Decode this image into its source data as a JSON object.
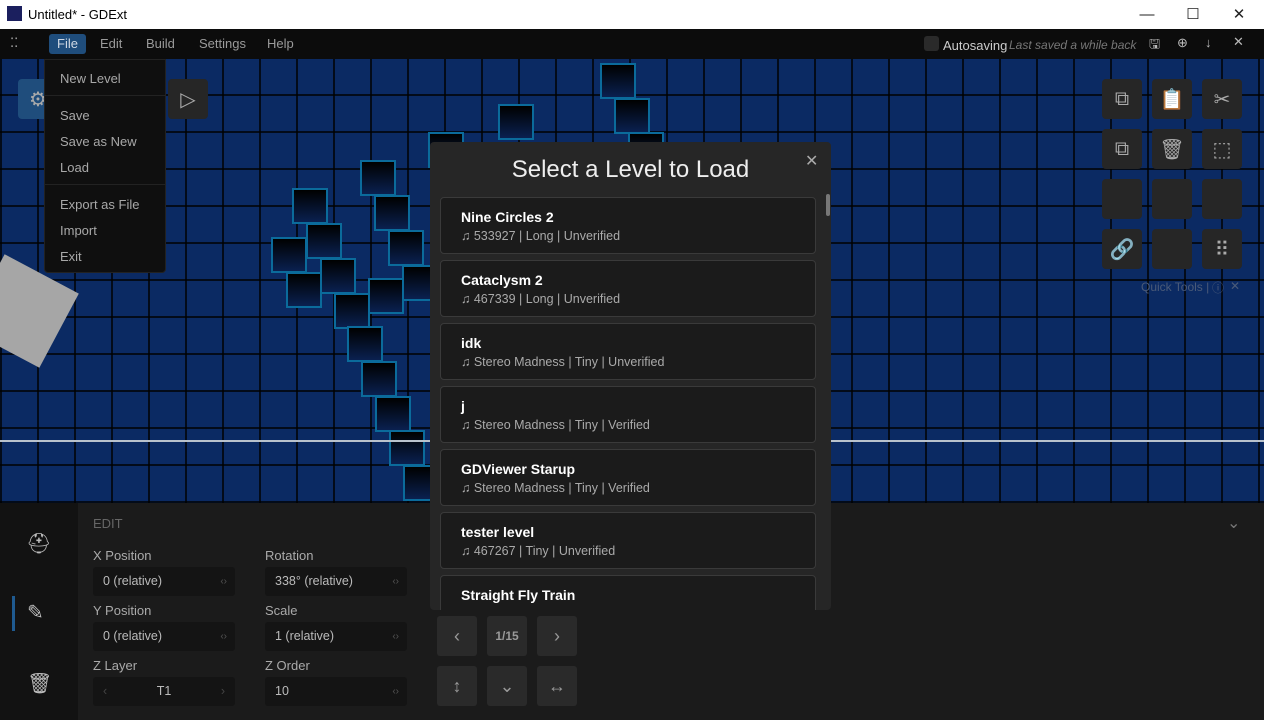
{
  "window": {
    "title": "Untitled* - GDExt",
    "minimize": "—",
    "maximize": "☐",
    "close": "✕"
  },
  "menubar": {
    "items": [
      "File",
      "Edit",
      "Build",
      "Settings",
      "Help"
    ],
    "autosave_label": "Autosaving",
    "last_saved": "Last saved a while back"
  },
  "file_menu": {
    "items": [
      "New Level",
      "Save",
      "Save as New",
      "Load",
      "Export as File",
      "Import",
      "Exit"
    ]
  },
  "quick_tools": {
    "label": "Quick Tools |"
  },
  "modal": {
    "title": "Select a Level to Load",
    "close": "✕",
    "levels": [
      {
        "name": "Nine Circles 2",
        "meta": "♫ 533927 | Long | Unverified"
      },
      {
        "name": "Cataclysm 2",
        "meta": "♫ 467339 | Long | Unverified"
      },
      {
        "name": "idk",
        "meta": "♫ Stereo Madness | Tiny | Unverified"
      },
      {
        "name": "j",
        "meta": "♫ Stereo Madness | Tiny | Verified"
      },
      {
        "name": "GDViewer Starup",
        "meta": "♫ Stereo Madness | Tiny | Verified"
      },
      {
        "name": "tester level",
        "meta": "♫ 467267 | Tiny | Unverified"
      },
      {
        "name": "Straight Fly Train",
        "meta": ""
      }
    ]
  },
  "edit": {
    "section": "EDIT",
    "x_label": "X Position",
    "x_value": "0 (relative)",
    "rot_label": "Rotation",
    "rot_value": "338° (relative)",
    "y_label": "Y Position",
    "y_value": "0 (relative)",
    "scale_label": "Scale",
    "scale_value": "1 (relative)",
    "zl_label": "Z Layer",
    "zl_value": "T1",
    "zo_label": "Z Order",
    "zo_value": "10",
    "page": "1/15"
  },
  "colors": {
    "accent": "#1f4d7c",
    "canvas": "#0b2a63",
    "block_border": "#0b6b9b"
  }
}
